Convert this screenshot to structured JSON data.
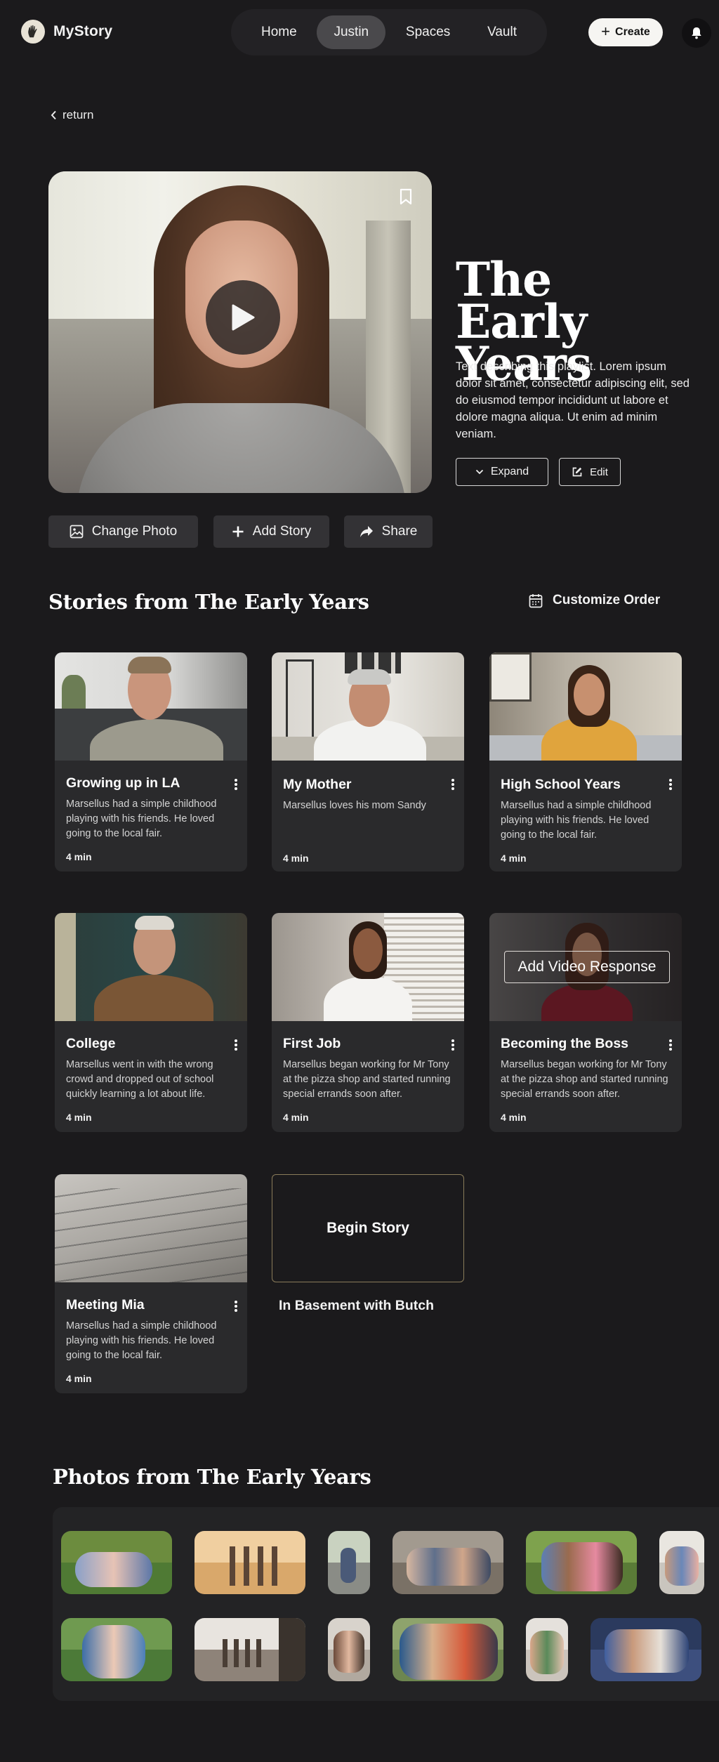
{
  "app": {
    "name": "MyStory"
  },
  "nav": {
    "items": [
      "Home",
      "Justin",
      "Spaces",
      "Vault"
    ],
    "active": "Justin"
  },
  "header": {
    "create_label": "Create"
  },
  "return_label": "return",
  "playlist": {
    "title": "The Early Years",
    "description": "Text describing this playlist. Lorem ipsum dolor sit amet, consectetur adipiscing elit, sed do eiusmod tempor incididunt ut labore et dolore magna aliqua. Ut enim ad minim veniam.",
    "expand_label": "Expand",
    "edit_label": "Edit"
  },
  "actions": {
    "change_photo": "Change Photo",
    "add_story": "Add Story",
    "share": "Share"
  },
  "stories_section": {
    "title": "Stories from The Early Years",
    "customize_label": "Customize Order",
    "stories": [
      {
        "title": "Growing up in LA",
        "desc": "Marsellus had a simple childhood playing with his friends. He loved going to the local fair.",
        "duration": "4 min"
      },
      {
        "title": "My Mother",
        "desc": "Marsellus loves his mom Sandy",
        "duration": "4 min"
      },
      {
        "title": "High School Years",
        "desc": "Marsellus had a simple childhood playing with his friends. He loved going to the local fair.",
        "duration": "4 min"
      },
      {
        "title": "College",
        "desc": "Marsellus went in with the wrong crowd and dropped out of school quickly learning a lot about life.",
        "duration": "4 min"
      },
      {
        "title": "First Job",
        "desc": "Marsellus began working for Mr Tony at the pizza shop and started running special errands soon after.",
        "duration": "4 min"
      },
      {
        "title": "Becoming the Boss",
        "desc": "Marsellus began working for Mr Tony at the pizza shop and started running special errands soon after.",
        "duration": "4 min",
        "overlay_label": "Add Video Response"
      },
      {
        "title": "Meeting Mia",
        "desc": "Marsellus had a simple childhood playing with his friends. He loved going to the local fair.",
        "duration": "4 min"
      }
    ],
    "begin_story": {
      "button_label": "Begin Story",
      "title": "In Basement with Butch"
    }
  },
  "photos_section": {
    "title": "Photos from The Early Years"
  },
  "colors": {
    "background": "#1b1a1c",
    "card": "#2a2a2c",
    "button": "#333235",
    "nav_active": "#4a494c",
    "begin_border": "#8a7c5a"
  },
  "icons": [
    "hand-logo-icon",
    "plus-icon",
    "bell-icon",
    "chevron-left-icon",
    "play-icon",
    "bookmark-icon",
    "chevron-down-icon",
    "edit-icon",
    "image-icon",
    "share-arrow-icon",
    "calendar-icon",
    "more-vertical-icon"
  ]
}
